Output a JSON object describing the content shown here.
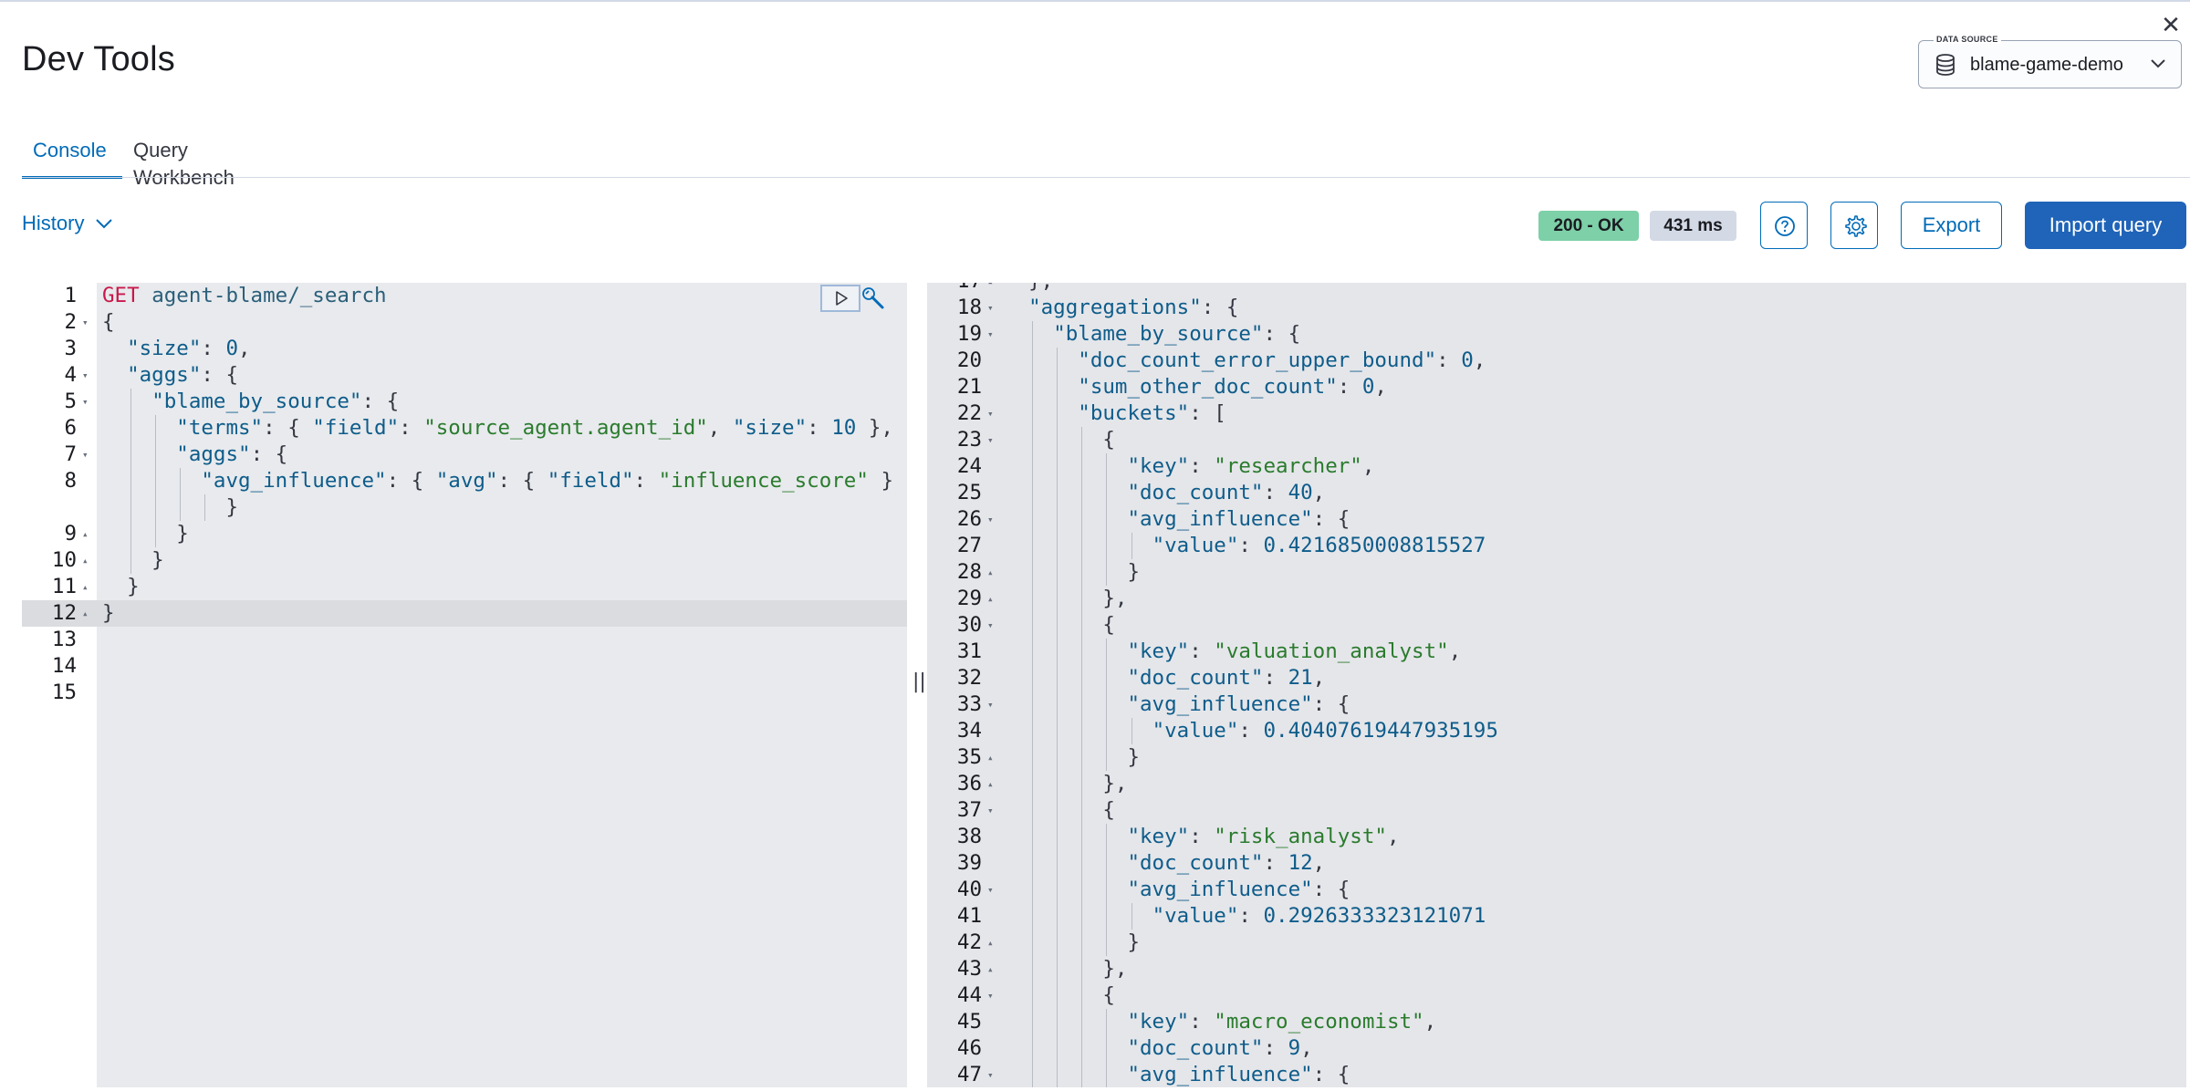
{
  "page": {
    "title": "Dev Tools",
    "close_glyph": "✕"
  },
  "data_source": {
    "legend": "DATA SOURCE",
    "value": "blame-game-demo",
    "icon": "database-icon"
  },
  "tabs": [
    {
      "label": "Console",
      "active": true
    },
    {
      "label": "Query Workbench",
      "active": false
    }
  ],
  "toolbar": {
    "history_label": "History",
    "status_badge": "200 - OK",
    "time_badge": "431 ms",
    "export_label": "Export",
    "import_label": "Import query",
    "status_color": "#7dd0a8",
    "accent_color": "#1f64b8"
  },
  "request_lines": [
    {
      "n": "1",
      "fold": "",
      "tokens": [
        [
          "m",
          "GET"
        ],
        [
          "p",
          " "
        ],
        [
          "path",
          "agent-blame/_search"
        ]
      ]
    },
    {
      "n": "2",
      "fold": "▾",
      "tokens": [
        [
          "p",
          "{"
        ]
      ]
    },
    {
      "n": "3",
      "fold": "",
      "tokens": [
        [
          "p",
          "  "
        ],
        [
          "k",
          "\"size\""
        ],
        [
          "p",
          ": "
        ],
        [
          "n",
          "0"
        ],
        [
          "p",
          ","
        ]
      ]
    },
    {
      "n": "4",
      "fold": "▾",
      "tokens": [
        [
          "p",
          "  "
        ],
        [
          "k",
          "\"aggs\""
        ],
        [
          "p",
          ": {"
        ]
      ]
    },
    {
      "n": "5",
      "fold": "▾",
      "tokens": [
        [
          "p",
          "    "
        ],
        [
          "k",
          "\"blame_by_source\""
        ],
        [
          "p",
          ": {"
        ]
      ]
    },
    {
      "n": "6",
      "fold": "",
      "tokens": [
        [
          "p",
          "      "
        ],
        [
          "k",
          "\"terms\""
        ],
        [
          "p",
          ": { "
        ],
        [
          "k",
          "\"field\""
        ],
        [
          "p",
          ": "
        ],
        [
          "s",
          "\"source_agent.agent_id\""
        ],
        [
          "p",
          ", "
        ],
        [
          "k",
          "\"size\""
        ],
        [
          "p",
          ": "
        ],
        [
          "n",
          "10"
        ],
        [
          "p",
          " },"
        ]
      ]
    },
    {
      "n": "7",
      "fold": "▾",
      "tokens": [
        [
          "p",
          "      "
        ],
        [
          "k",
          "\"aggs\""
        ],
        [
          "p",
          ": {"
        ]
      ]
    },
    {
      "n": "8",
      "fold": "",
      "tokens": [
        [
          "p",
          "        "
        ],
        [
          "k",
          "\"avg_influence\""
        ],
        [
          "p",
          ": { "
        ],
        [
          "k",
          "\"avg\""
        ],
        [
          "p",
          ": { "
        ],
        [
          "k",
          "\"field\""
        ],
        [
          "p",
          ": "
        ],
        [
          "s",
          "\"influence_score\""
        ],
        [
          "p",
          " }"
        ]
      ]
    },
    {
      "n": "",
      "fold": "",
      "tokens": [
        [
          "p",
          "          }"
        ]
      ]
    },
    {
      "n": "9",
      "fold": "▴",
      "tokens": [
        [
          "p",
          "      }"
        ]
      ]
    },
    {
      "n": "10",
      "fold": "▴",
      "tokens": [
        [
          "p",
          "    }"
        ]
      ]
    },
    {
      "n": "11",
      "fold": "▴",
      "tokens": [
        [
          "p",
          "  }"
        ]
      ]
    },
    {
      "n": "12",
      "fold": "▴",
      "tokens": [
        [
          "p",
          "}"
        ]
      ]
    },
    {
      "n": "13",
      "fold": "",
      "tokens": []
    },
    {
      "n": "14",
      "fold": "",
      "tokens": []
    },
    {
      "n": "15",
      "fold": "",
      "tokens": []
    }
  ],
  "response_lines": [
    {
      "n": "17",
      "fold": "▴",
      "tokens": [
        [
          "p",
          "  },"
        ]
      ]
    },
    {
      "n": "18",
      "fold": "▾",
      "tokens": [
        [
          "p",
          "  "
        ],
        [
          "k",
          "\"aggregations\""
        ],
        [
          "p",
          ": {"
        ]
      ]
    },
    {
      "n": "19",
      "fold": "▾",
      "tokens": [
        [
          "p",
          "    "
        ],
        [
          "k",
          "\"blame_by_source\""
        ],
        [
          "p",
          ": {"
        ]
      ]
    },
    {
      "n": "20",
      "fold": "",
      "tokens": [
        [
          "p",
          "      "
        ],
        [
          "k",
          "\"doc_count_error_upper_bound\""
        ],
        [
          "p",
          ": "
        ],
        [
          "n",
          "0"
        ],
        [
          "p",
          ","
        ]
      ]
    },
    {
      "n": "21",
      "fold": "",
      "tokens": [
        [
          "p",
          "      "
        ],
        [
          "k",
          "\"sum_other_doc_count\""
        ],
        [
          "p",
          ": "
        ],
        [
          "n",
          "0"
        ],
        [
          "p",
          ","
        ]
      ]
    },
    {
      "n": "22",
      "fold": "▾",
      "tokens": [
        [
          "p",
          "      "
        ],
        [
          "k",
          "\"buckets\""
        ],
        [
          "p",
          ": ["
        ]
      ]
    },
    {
      "n": "23",
      "fold": "▾",
      "tokens": [
        [
          "p",
          "        {"
        ]
      ]
    },
    {
      "n": "24",
      "fold": "",
      "tokens": [
        [
          "p",
          "          "
        ],
        [
          "k",
          "\"key\""
        ],
        [
          "p",
          ": "
        ],
        [
          "s",
          "\"researcher\""
        ],
        [
          "p",
          ","
        ]
      ]
    },
    {
      "n": "25",
      "fold": "",
      "tokens": [
        [
          "p",
          "          "
        ],
        [
          "k",
          "\"doc_count\""
        ],
        [
          "p",
          ": "
        ],
        [
          "n",
          "40"
        ],
        [
          "p",
          ","
        ]
      ]
    },
    {
      "n": "26",
      "fold": "▾",
      "tokens": [
        [
          "p",
          "          "
        ],
        [
          "k",
          "\"avg_influence\""
        ],
        [
          "p",
          ": {"
        ]
      ]
    },
    {
      "n": "27",
      "fold": "",
      "tokens": [
        [
          "p",
          "            "
        ],
        [
          "k",
          "\"value\""
        ],
        [
          "p",
          ": "
        ],
        [
          "n",
          "0.4216850008815527"
        ]
      ]
    },
    {
      "n": "28",
      "fold": "▴",
      "tokens": [
        [
          "p",
          "          }"
        ]
      ]
    },
    {
      "n": "29",
      "fold": "▴",
      "tokens": [
        [
          "p",
          "        },"
        ]
      ]
    },
    {
      "n": "30",
      "fold": "▾",
      "tokens": [
        [
          "p",
          "        {"
        ]
      ]
    },
    {
      "n": "31",
      "fold": "",
      "tokens": [
        [
          "p",
          "          "
        ],
        [
          "k",
          "\"key\""
        ],
        [
          "p",
          ": "
        ],
        [
          "s",
          "\"valuation_analyst\""
        ],
        [
          "p",
          ","
        ]
      ]
    },
    {
      "n": "32",
      "fold": "",
      "tokens": [
        [
          "p",
          "          "
        ],
        [
          "k",
          "\"doc_count\""
        ],
        [
          "p",
          ": "
        ],
        [
          "n",
          "21"
        ],
        [
          "p",
          ","
        ]
      ]
    },
    {
      "n": "33",
      "fold": "▾",
      "tokens": [
        [
          "p",
          "          "
        ],
        [
          "k",
          "\"avg_influence\""
        ],
        [
          "p",
          ": {"
        ]
      ]
    },
    {
      "n": "34",
      "fold": "",
      "tokens": [
        [
          "p",
          "            "
        ],
        [
          "k",
          "\"value\""
        ],
        [
          "p",
          ": "
        ],
        [
          "n",
          "0.40407619447935195"
        ]
      ]
    },
    {
      "n": "35",
      "fold": "▴",
      "tokens": [
        [
          "p",
          "          }"
        ]
      ]
    },
    {
      "n": "36",
      "fold": "▴",
      "tokens": [
        [
          "p",
          "        },"
        ]
      ]
    },
    {
      "n": "37",
      "fold": "▾",
      "tokens": [
        [
          "p",
          "        {"
        ]
      ]
    },
    {
      "n": "38",
      "fold": "",
      "tokens": [
        [
          "p",
          "          "
        ],
        [
          "k",
          "\"key\""
        ],
        [
          "p",
          ": "
        ],
        [
          "s",
          "\"risk_analyst\""
        ],
        [
          "p",
          ","
        ]
      ]
    },
    {
      "n": "39",
      "fold": "",
      "tokens": [
        [
          "p",
          "          "
        ],
        [
          "k",
          "\"doc_count\""
        ],
        [
          "p",
          ": "
        ],
        [
          "n",
          "12"
        ],
        [
          "p",
          ","
        ]
      ]
    },
    {
      "n": "40",
      "fold": "▾",
      "tokens": [
        [
          "p",
          "          "
        ],
        [
          "k",
          "\"avg_influence\""
        ],
        [
          "p",
          ": {"
        ]
      ]
    },
    {
      "n": "41",
      "fold": "",
      "tokens": [
        [
          "p",
          "            "
        ],
        [
          "k",
          "\"value\""
        ],
        [
          "p",
          ": "
        ],
        [
          "n",
          "0.2926333323121071"
        ]
      ]
    },
    {
      "n": "42",
      "fold": "▴",
      "tokens": [
        [
          "p",
          "          }"
        ]
      ]
    },
    {
      "n": "43",
      "fold": "▴",
      "tokens": [
        [
          "p",
          "        },"
        ]
      ]
    },
    {
      "n": "44",
      "fold": "▾",
      "tokens": [
        [
          "p",
          "        {"
        ]
      ]
    },
    {
      "n": "45",
      "fold": "",
      "tokens": [
        [
          "p",
          "          "
        ],
        [
          "k",
          "\"key\""
        ],
        [
          "p",
          ": "
        ],
        [
          "s",
          "\"macro_economist\""
        ],
        [
          "p",
          ","
        ]
      ]
    },
    {
      "n": "46",
      "fold": "",
      "tokens": [
        [
          "p",
          "          "
        ],
        [
          "k",
          "\"doc_count\""
        ],
        [
          "p",
          ": "
        ],
        [
          "n",
          "9"
        ],
        [
          "p",
          ","
        ]
      ]
    },
    {
      "n": "47",
      "fold": "▾",
      "tokens": [
        [
          "p",
          "          "
        ],
        [
          "k",
          "\"avg_influence\""
        ],
        [
          "p",
          ": {"
        ]
      ]
    }
  ],
  "divider_glyph": "||"
}
